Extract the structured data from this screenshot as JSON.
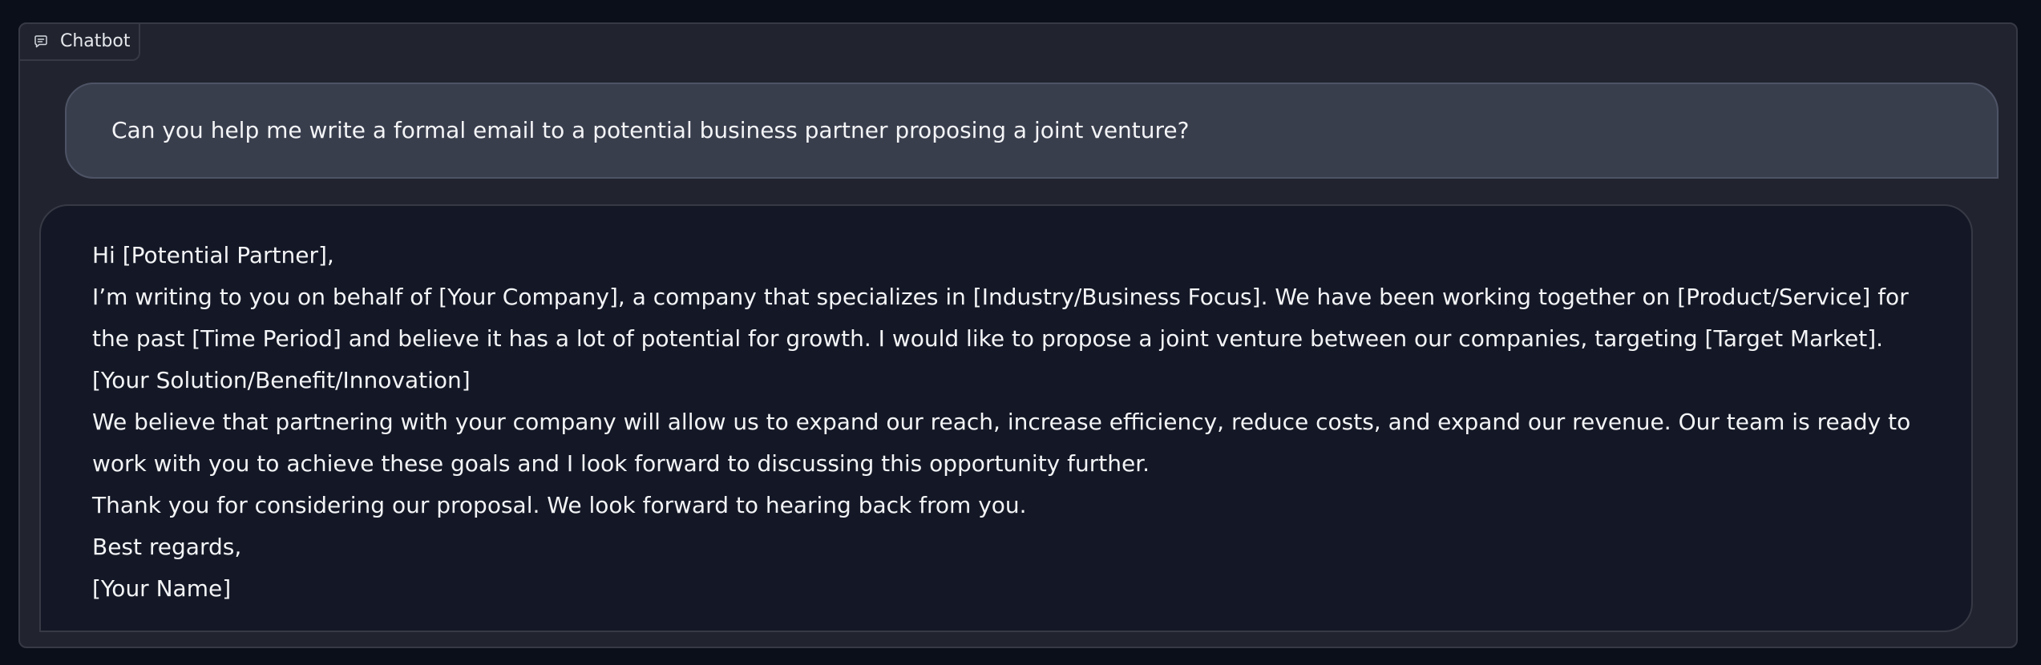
{
  "panel": {
    "label": "Chatbot",
    "label_icon": "chat-icon"
  },
  "messages": [
    {
      "role": "user",
      "text": "Can you help me write a formal email to a potential business partner proposing a joint venture?"
    },
    {
      "role": "assistant",
      "lines": [
        "Hi [Potential Partner],",
        "I’m writing to you on behalf of [Your Company], a company that specializes in [Industry/Business Focus]. We have been working together on [Product/Service] for the past [Time Period] and believe it has a lot of potential for growth. I would like to propose a joint venture between our companies, targeting [Target Market].",
        "[Your Solution/Benefit/Innovation]",
        "We believe that partnering with your company will allow us to expand our reach, increase efficiency, reduce costs, and expand our revenue. Our team is ready to work with you to achieve these goals and I look forward to discussing this opportunity further.",
        "Thank you for considering our proposal. We look forward to hearing back from you.",
        "Best regards,",
        "[Your Name]"
      ]
    }
  ]
}
